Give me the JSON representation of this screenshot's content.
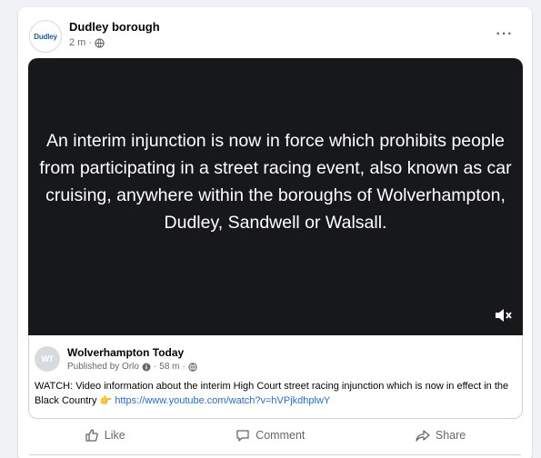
{
  "post": {
    "author": "Dudley borough",
    "avatar_text": "Dudley",
    "time": "2 m",
    "separator": "·",
    "privacy_icon": "globe-icon",
    "more_icon": "more-options-icon",
    "more_label": "···"
  },
  "video": {
    "caption": "An interim injunction is now in force which prohibits people from participating in a street racing event, also known as car cruising, anywhere within the boroughs of Wolverhampton, Dudley, Sandwell or Walsall.",
    "mute_icon": "mute-icon"
  },
  "shared_post": {
    "author": "Wolverhampton Today",
    "avatar_text": "WT",
    "published_by": "Published by Orlo",
    "time": "58 m",
    "separator": "·",
    "body": "WATCH: Video information about the interim High Court street racing injunction which is now in effect in the Black Country",
    "emoji": "👉",
    "link": "https://www.youtube.com/watch?v=hVPjkdhplwY"
  },
  "actions": {
    "like": "Like",
    "comment": "Comment",
    "share": "Share"
  },
  "colors": {
    "accent": "#216fdb",
    "video_bg": "#17181a",
    "muted_text": "#65676b"
  }
}
